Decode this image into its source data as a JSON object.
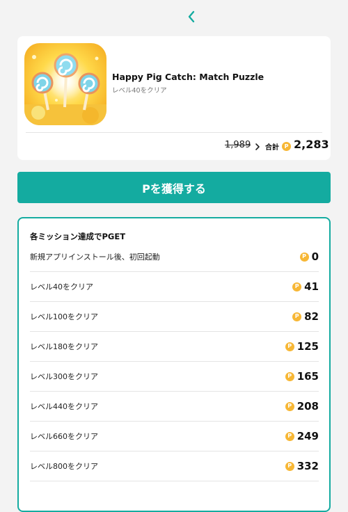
{
  "header": {
    "back_icon": "chevron-left-icon"
  },
  "app": {
    "title": "Happy Pig Catch: Match Puzzle",
    "subtitle": "レベル40をクリア",
    "old_price": "1,989",
    "total_label": "合計",
    "total_value": "2,283",
    "coin_symbol": "P"
  },
  "cta": {
    "label": "Pを獲得する"
  },
  "missions": {
    "title": "各ミッション達成でPGET",
    "items": [
      {
        "label": "新規アプリインストール後、初回起動",
        "value": "0"
      },
      {
        "label": "レベル40をクリア",
        "value": "41"
      },
      {
        "label": "レベル100をクリア",
        "value": "82"
      },
      {
        "label": "レベル180をクリア",
        "value": "125"
      },
      {
        "label": "レベル300をクリア",
        "value": "165"
      },
      {
        "label": "レベル440をクリア",
        "value": "208"
      },
      {
        "label": "レベル660をクリア",
        "value": "249"
      },
      {
        "label": "レベル800をクリア",
        "value": "332"
      }
    ]
  },
  "colors": {
    "accent": "#14aba0",
    "coin": "#f7b735",
    "background": "#f3f3f3"
  }
}
